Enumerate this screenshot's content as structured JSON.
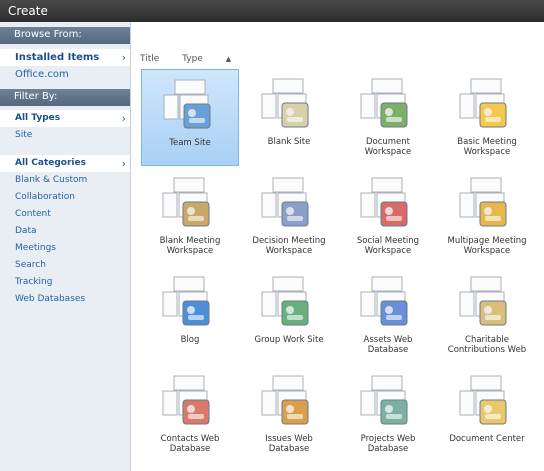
{
  "window": {
    "title": "Create"
  },
  "sidebar": {
    "browse_heading": "Browse From:",
    "browse_items": [
      {
        "label": "Installed Items",
        "selected": true
      },
      {
        "label": "Office.com",
        "selected": false
      }
    ],
    "filter_heading": "Filter By:",
    "type_items": [
      {
        "label": "All Types",
        "selected": true
      },
      {
        "label": "Site",
        "selected": false
      }
    ],
    "category_items": [
      {
        "label": "All Categories",
        "selected": true
      },
      {
        "label": "Blank & Custom"
      },
      {
        "label": "Collaboration"
      },
      {
        "label": "Content"
      },
      {
        "label": "Data"
      },
      {
        "label": "Meetings"
      },
      {
        "label": "Search"
      },
      {
        "label": "Tracking"
      },
      {
        "label": "Web Databases"
      }
    ]
  },
  "sort": {
    "title_label": "Title",
    "type_label": "Type",
    "type_arrow": "▲"
  },
  "templates": [
    {
      "line1": "Team Site",
      "line2": "",
      "icon": "team-site-icon",
      "selected": true
    },
    {
      "line1": "Blank Site",
      "line2": "",
      "icon": "blank-site-icon"
    },
    {
      "line1": "Document",
      "line2": "Workspace",
      "icon": "document-workspace-icon"
    },
    {
      "line1": "Basic Meeting",
      "line2": "Workspace",
      "icon": "basic-meeting-icon"
    },
    {
      "line1": "Blank Meeting",
      "line2": "Workspace",
      "icon": "blank-meeting-icon"
    },
    {
      "line1": "Decision Meeting",
      "line2": "Workspace",
      "icon": "decision-meeting-icon"
    },
    {
      "line1": "Social Meeting",
      "line2": "Workspace",
      "icon": "social-meeting-icon"
    },
    {
      "line1": "Multipage Meeting",
      "line2": "Workspace",
      "icon": "multipage-meeting-icon"
    },
    {
      "line1": "Blog",
      "line2": "",
      "icon": "blog-icon"
    },
    {
      "line1": "Group Work Site",
      "line2": "",
      "icon": "group-work-icon"
    },
    {
      "line1": "Assets Web",
      "line2": "Database",
      "icon": "assets-database-icon"
    },
    {
      "line1": "Charitable",
      "line2": "Contributions Web",
      "icon": "charitable-icon"
    },
    {
      "line1": "Contacts Web",
      "line2": "Database",
      "icon": "contacts-database-icon"
    },
    {
      "line1": "Issues Web",
      "line2": "Database",
      "icon": "issues-database-icon"
    },
    {
      "line1": "Projects Web",
      "line2": "Database",
      "icon": "projects-database-icon"
    },
    {
      "line1": "Document Center",
      "line2": "",
      "icon": "document-center-icon"
    }
  ]
}
